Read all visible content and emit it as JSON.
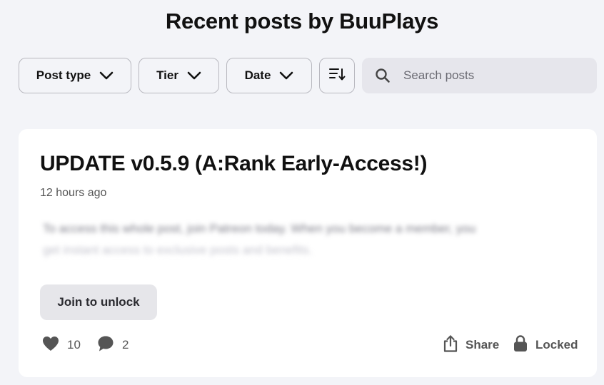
{
  "page": {
    "title": "Recent posts by BuuPlays"
  },
  "filters": {
    "post_type": "Post type",
    "tier": "Tier",
    "date": "Date"
  },
  "search": {
    "placeholder": "Search posts"
  },
  "post": {
    "title": "UPDATE v0.5.9 (A:Rank Early-Access!)",
    "time": "12 hours ago",
    "blurred_line_1": "To access this whole post, join Patreon today. When you become a member, you",
    "blurred_line_2": "get instant access to exclusive posts and benefits.",
    "join_label": "Join to unlock",
    "likes": "10",
    "comments": "2",
    "share_label": "Share",
    "locked_label": "Locked"
  },
  "icons": {
    "chevron": "chevron-down-icon",
    "sort": "sort-icon",
    "search": "search-icon",
    "heart": "heart-icon",
    "comment": "comment-icon",
    "share": "share-icon",
    "lock": "lock-icon"
  },
  "colors": {
    "background": "#f3f4f8",
    "card": "#ffffff",
    "icon": "#555555"
  }
}
